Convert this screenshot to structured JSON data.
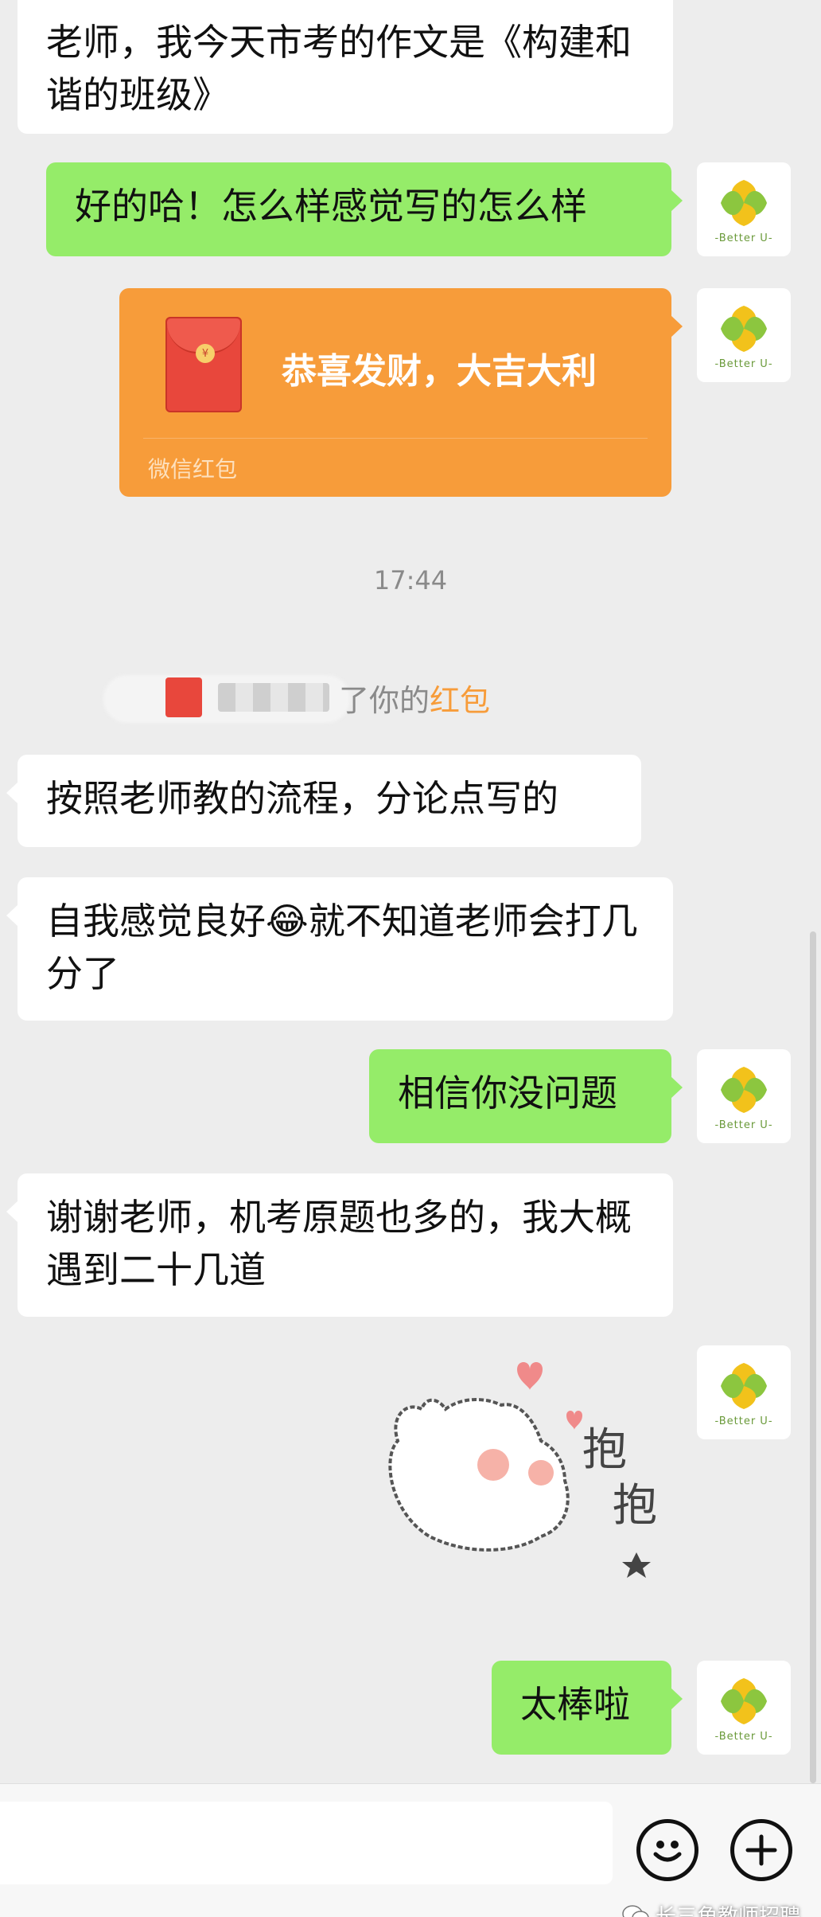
{
  "messages": [
    {
      "side": "left",
      "text": "老师，我今天市考的作文是《构建和谐的班级》"
    },
    {
      "side": "right",
      "text": "好的哈！怎么样感觉写的怎么样"
    },
    {
      "side": "left",
      "text": "按照老师教的流程，分论点写的"
    },
    {
      "side": "left",
      "text": "自我感觉良好😂就不知道老师会打几分了"
    },
    {
      "side": "right",
      "text": "相信你没问题"
    },
    {
      "side": "left",
      "text": "谢谢老师，机考原题也多的，我大概遇到二十几道"
    },
    {
      "side": "right",
      "text": "太棒啦"
    }
  ],
  "red_packet": {
    "title": "恭喜发财，大吉大利",
    "label": "微信红包"
  },
  "timestamp": "17:44",
  "system_notice": {
    "text": "了你的",
    "highlight": "红包"
  },
  "avatar": {
    "text": "-Better U-"
  },
  "sticker": {
    "caption": "抱抱"
  },
  "watermark": "长三角教师招聘",
  "colors": {
    "self_bubble": "#95ec69",
    "other_bubble": "#ffffff",
    "red_packet": "#f79c3a",
    "background": "#ededed"
  },
  "icons": [
    "emoji-icon",
    "plus-icon",
    "wechat-icon"
  ]
}
